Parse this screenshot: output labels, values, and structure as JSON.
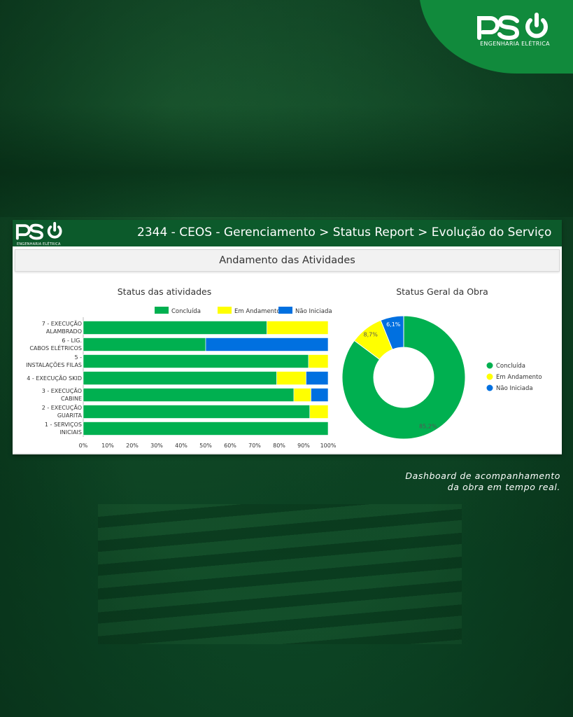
{
  "brand": {
    "logo_text": "PSO",
    "subtitle": "ENGENHARIA ELÉTRICA",
    "color_green": "#118a3c"
  },
  "dashboard": {
    "header_title": "2344 - CEOS - Gerenciamento > Status Report > Evolução do Serviço",
    "section_title": "Andamento das Atividades"
  },
  "caption": {
    "line1": "Dashboard de acompanhamento",
    "line2": "da obra em tempo real."
  },
  "colors": {
    "concluida": "#00b050",
    "em_andamento": "#ffff00",
    "nao_iniciada": "#0070e0",
    "header_bg": "#0c5a2b"
  },
  "chart_data": [
    {
      "type": "bar",
      "orientation": "horizontal",
      "stacked": "percent",
      "title": "Status das atividades",
      "legend_position": "top",
      "categories": [
        "7 - EXECUÇÃO ALAMBRADO",
        "6 - LIG. CABOS ELÉTRICOS",
        "5 - INSTALAÇÕES FILAS",
        "4 - EXECUÇÃO SKID",
        "3 - EXECUÇÃO CABINE",
        "2 - EXECUÇÃO GUARITA",
        "1 - SERVIÇOS INICIAIS"
      ],
      "series": [
        {
          "name": "Concluída",
          "values": [
            75,
            50,
            92,
            79,
            86,
            92.5,
            100
          ]
        },
        {
          "name": "Em Andamento",
          "values": [
            25,
            0,
            8,
            12,
            7,
            7.5,
            0
          ]
        },
        {
          "name": "Não Iniciada",
          "values": [
            0,
            50,
            0,
            9,
            7,
            0,
            0
          ]
        }
      ],
      "x_ticks": [
        "0%",
        "10%",
        "20%",
        "30%",
        "40%",
        "50%",
        "60%",
        "70%",
        "80%",
        "90%",
        "100%"
      ],
      "xlim": [
        0,
        100
      ]
    },
    {
      "type": "pie",
      "donut": true,
      "title": "Status Geral da Obra",
      "legend_position": "right",
      "labels": [
        "Concluída",
        "Em Andamento",
        "Não Iniciada"
      ],
      "values": [
        85.2,
        8.7,
        6.1
      ],
      "value_labels": [
        "85,2%",
        "8,7%",
        "6,1%"
      ]
    }
  ]
}
